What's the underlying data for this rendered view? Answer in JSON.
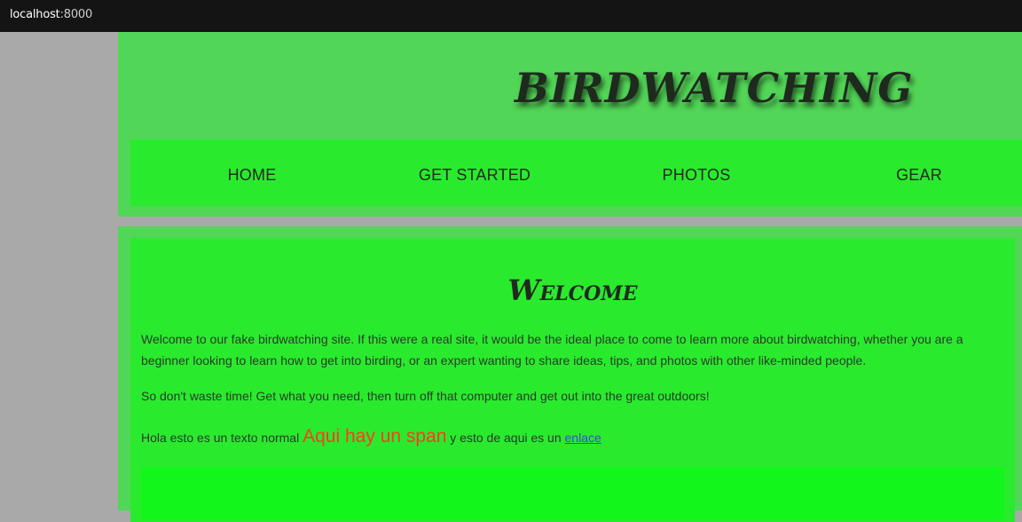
{
  "browser": {
    "host": "localhost",
    "port": ":8000"
  },
  "header": {
    "title": "BIRDWATCHING"
  },
  "nav": {
    "items": [
      "HOME",
      "GET STARTED",
      "PHOTOS",
      "GEAR"
    ]
  },
  "main": {
    "heading": "Welcome",
    "paragraph1": "Welcome to our fake birdwatching site. If this were a real site, it would be the ideal place to come to learn more about birdwatching, whether you are a beginner looking to learn how to get into birding, or an expert wanting to share ideas, tips, and photos with other like-minded people.",
    "paragraph2": "So don't waste time! Get what you need, then turn off that computer and get out into the great outdoors!",
    "line3_text": "Hola esto es un texto normal ",
    "line3_span": "Aqui hay un span",
    "line3_mid": " y esto de aqui es un ",
    "line3_link": "enlace"
  },
  "colors": {
    "page_bg": "#a9a9a9",
    "header_bg": "#52d657",
    "nav_bg": "#2aea2e",
    "subsection_bg": "#13f61b",
    "span_color": "#ff3b1a",
    "link_color": "#3a4bd6"
  }
}
